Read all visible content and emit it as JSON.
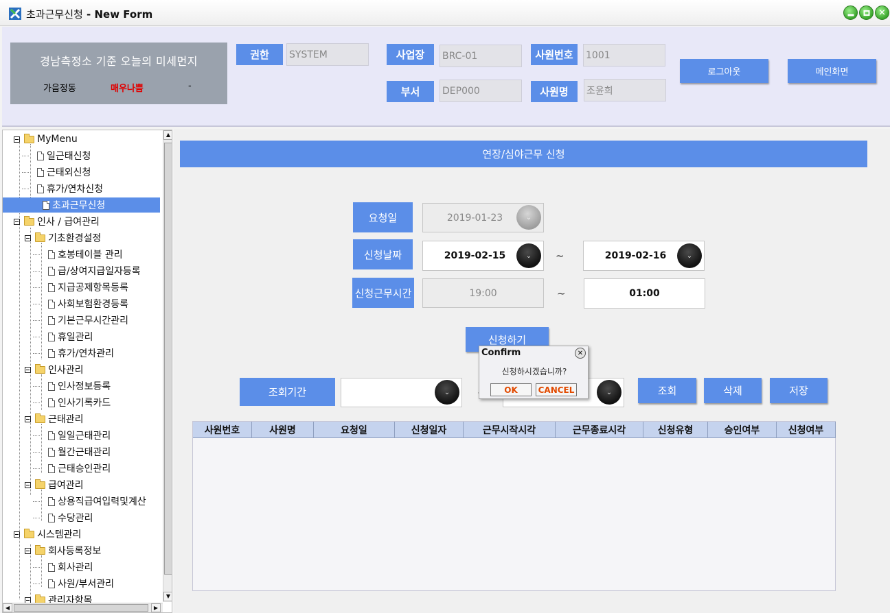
{
  "window": {
    "title_app": "초과근무신청",
    "title_sep": " - ",
    "title_form": "New Form"
  },
  "dust": {
    "title": "경남측정소 기준 오늘의 미세먼지",
    "area": "가음정동",
    "level": "매우나쁨",
    "value": "-"
  },
  "header": {
    "role_label": "권한",
    "role_value": "SYSTEM",
    "site_label": "사업장",
    "site_value": "BRC-01",
    "dept_label": "부서",
    "dept_value": "DEP000",
    "emp_no_label": "사원번호",
    "emp_no_value": "1001",
    "emp_name_label": "사원명",
    "emp_name_value": "조윤희",
    "logout_label": "로그아웃",
    "main_label": "메인화면"
  },
  "tree": [
    {
      "label": "MyMenu",
      "type": "folder"
    },
    {
      "label": "일근태신청",
      "type": "doc"
    },
    {
      "label": "근태외신청",
      "type": "doc"
    },
    {
      "label": "휴가/연차신청",
      "type": "doc"
    },
    {
      "label": "초과근무신청",
      "type": "doc",
      "selected": true
    },
    {
      "label": "인사 / 급여관리",
      "type": "folder"
    },
    {
      "label": "기초환경설정",
      "type": "folder"
    },
    {
      "label": "호봉테이블 관리",
      "type": "doc"
    },
    {
      "label": "급/상여지급일자등록",
      "type": "doc"
    },
    {
      "label": "지급공제항목등록",
      "type": "doc"
    },
    {
      "label": "사회보험환경등록",
      "type": "doc"
    },
    {
      "label": "기본근무시간관리",
      "type": "doc"
    },
    {
      "label": "휴일관리",
      "type": "doc"
    },
    {
      "label": "휴가/연차관리",
      "type": "doc"
    },
    {
      "label": "인사관리",
      "type": "folder"
    },
    {
      "label": "인사정보등록",
      "type": "doc"
    },
    {
      "label": "인사기록카드",
      "type": "doc"
    },
    {
      "label": "근태관리",
      "type": "folder"
    },
    {
      "label": "일일근태관리",
      "type": "doc"
    },
    {
      "label": "월간근태관리",
      "type": "doc"
    },
    {
      "label": "근태승인관리",
      "type": "doc"
    },
    {
      "label": "급여관리",
      "type": "folder"
    },
    {
      "label": "상용직급여입력및계산",
      "type": "doc"
    },
    {
      "label": "수당관리",
      "type": "doc"
    },
    {
      "label": "시스템관리",
      "type": "folder"
    },
    {
      "label": "회사등록정보",
      "type": "folder"
    },
    {
      "label": "회사관리",
      "type": "doc"
    },
    {
      "label": "사원/부서관리",
      "type": "doc"
    },
    {
      "label": "관리자항목",
      "type": "folder"
    }
  ],
  "form": {
    "page_title": "연장/심야근무 신청",
    "request_date_label": "요청일",
    "request_date_value": "2019-01-23",
    "apply_date_label": "신청날짜",
    "apply_date_from": "2019-02-15",
    "apply_date_to": "2019-02-16",
    "work_time_label": "신청근무시간",
    "work_time_from": "19:00",
    "work_time_to": "01:00",
    "tilde": "~",
    "submit_label": "신청하기",
    "period_label": "조회기간",
    "search_label": "조회",
    "delete_label": "삭제",
    "save_label": "저장"
  },
  "grid": {
    "columns": [
      "사원번호",
      "사원명",
      "요청일",
      "신청일자",
      "근무시작시각",
      "근무종료시각",
      "신청유형",
      "승인여부",
      "신청여부"
    ],
    "rows": []
  },
  "dialog": {
    "title": "Confirm",
    "message": "신청하시겠습니까?",
    "ok_label": "OK",
    "cancel_label": "CANCEL"
  },
  "colors": {
    "accent": "#5b8ee8",
    "warning_text": "#e00000",
    "dialog_button_text": "#e24a00"
  },
  "icons": {
    "app": "app-logo-icon",
    "minimize": "minimize-icon",
    "maximize": "maximize-icon",
    "close": "close-icon",
    "combo": "chevron-down-icon"
  }
}
